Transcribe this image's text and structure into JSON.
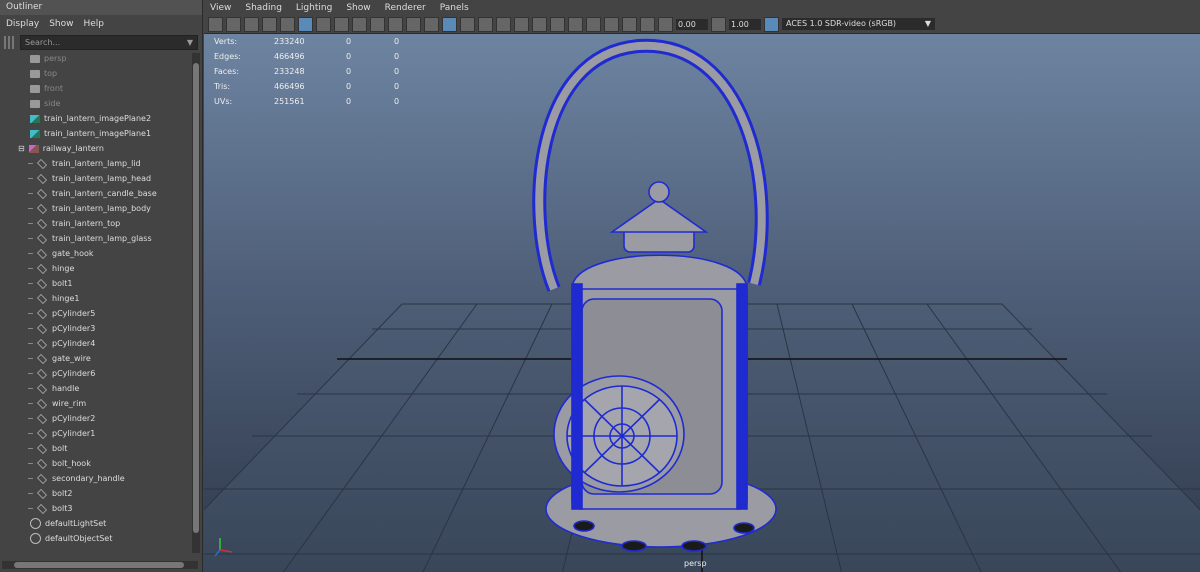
{
  "outliner": {
    "title": "Outliner",
    "menu": [
      "Display",
      "Show",
      "Help"
    ],
    "search_placeholder": "Search...",
    "items": [
      {
        "label": "persp",
        "kind": "camera",
        "dim": true
      },
      {
        "label": "top",
        "kind": "camera",
        "dim": true
      },
      {
        "label": "front",
        "kind": "camera",
        "dim": true
      },
      {
        "label": "side",
        "kind": "camera",
        "dim": true
      },
      {
        "label": "train_lantern_imagePlane2",
        "kind": "imageplane"
      },
      {
        "label": "train_lantern_imagePlane1",
        "kind": "imageplane"
      },
      {
        "label": "railway_lantern",
        "kind": "group",
        "expander": "⊟"
      },
      {
        "label": "train_lantern_lamp_lid",
        "kind": "mesh"
      },
      {
        "label": "train_lantern_lamp_head",
        "kind": "mesh"
      },
      {
        "label": "train_lantern_candle_base",
        "kind": "mesh"
      },
      {
        "label": "train_lantern_lamp_body",
        "kind": "mesh"
      },
      {
        "label": "train_lantern_top",
        "kind": "mesh"
      },
      {
        "label": "train_lantern_lamp_glass",
        "kind": "mesh"
      },
      {
        "label": "gate_hook",
        "kind": "mesh"
      },
      {
        "label": "hinge",
        "kind": "mesh"
      },
      {
        "label": "bolt1",
        "kind": "mesh"
      },
      {
        "label": "hinge1",
        "kind": "mesh"
      },
      {
        "label": "pCylinder5",
        "kind": "mesh"
      },
      {
        "label": "pCylinder3",
        "kind": "mesh"
      },
      {
        "label": "pCylinder4",
        "kind": "mesh"
      },
      {
        "label": "gate_wire",
        "kind": "mesh"
      },
      {
        "label": "pCylinder6",
        "kind": "mesh"
      },
      {
        "label": "handle",
        "kind": "mesh"
      },
      {
        "label": "wire_rim",
        "kind": "mesh"
      },
      {
        "label": "pCylinder2",
        "kind": "mesh"
      },
      {
        "label": "pCylinder1",
        "kind": "mesh"
      },
      {
        "label": "bolt",
        "kind": "mesh"
      },
      {
        "label": "bolt_hook",
        "kind": "mesh"
      },
      {
        "label": "secondary_handle",
        "kind": "mesh"
      },
      {
        "label": "bolt2",
        "kind": "mesh"
      },
      {
        "label": "bolt3",
        "kind": "mesh"
      },
      {
        "label": "defaultLightSet",
        "kind": "set"
      },
      {
        "label": "defaultObjectSet",
        "kind": "set"
      }
    ]
  },
  "viewport": {
    "menu": [
      "View",
      "Shading",
      "Lighting",
      "Show",
      "Renderer",
      "Panels"
    ],
    "exposure": "0.00",
    "gamma": "1.00",
    "color_transform": "ACES 1.0 SDR-video (sRGB)",
    "camera_label": "persp",
    "hud": [
      {
        "label": "Verts:",
        "v1": "233240",
        "v2": "0",
        "v3": "0"
      },
      {
        "label": "Edges:",
        "v1": "466496",
        "v2": "0",
        "v3": "0"
      },
      {
        "label": "Faces:",
        "v1": "233248",
        "v2": "0",
        "v3": "0"
      },
      {
        "label": "Tris:",
        "v1": "466496",
        "v2": "0",
        "v3": "0"
      },
      {
        "label": "UVs:",
        "v1": "251561",
        "v2": "0",
        "v3": "0"
      }
    ]
  },
  "colors": {
    "wire": "#1f2bd0",
    "mesh": "#9b9ba3",
    "grid": "#2b3444"
  }
}
